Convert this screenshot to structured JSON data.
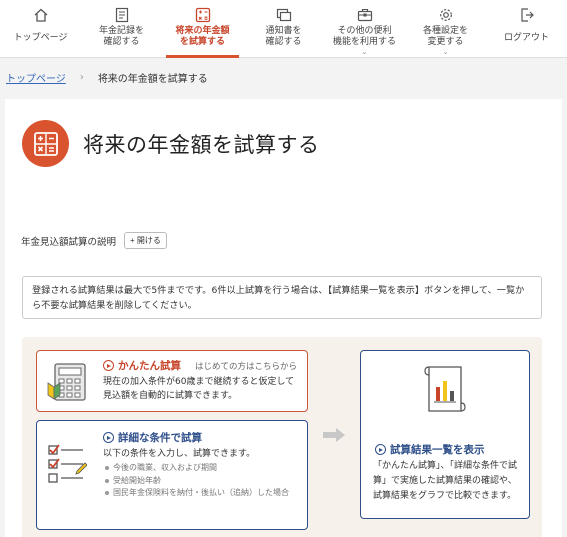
{
  "nav": {
    "items": [
      {
        "label": "トップページ",
        "icon": "home-icon"
      },
      {
        "label": "年金記録を\n確認する",
        "icon": "record-icon"
      },
      {
        "label": "将来の年金額\nを試算する",
        "icon": "calculator-icon",
        "active": true
      },
      {
        "label": "通知書を\n確認する",
        "icon": "notice-icon"
      },
      {
        "label": "その他の便利\n機能を利用する",
        "icon": "toolbox-icon",
        "chevron": "⌄"
      },
      {
        "label": "各種設定を\n変更する",
        "icon": "gear-icon",
        "chevron": "⌄"
      },
      {
        "label": "ログアウト",
        "icon": "logout-icon"
      }
    ]
  },
  "breadcrumb": {
    "home": "トップページ",
    "separator": "›",
    "current": "将来の年金額を試算する"
  },
  "page": {
    "title": "将来の年金額を試算する",
    "explain_label": "年金見込額試算の説明",
    "open_button": "+ 開ける",
    "notice": "登録される試算結果は最大で5件までです。6件以上試算を行う場合は、【試算結果一覧を表示】ボタンを押して、一覧から不要な試算結果を削除してください。"
  },
  "cards": {
    "easy": {
      "title": "かんたん試算",
      "subtitle": "はじめての方はこちらから",
      "body": "現在の加入条件が60歳まで継続すると仮定して見込額を自動的に試算できます。"
    },
    "detail": {
      "title": "詳細な条件で試算",
      "body": "以下の条件を入力し、試算できます。",
      "bullets": [
        "今後の職業、収入および期間",
        "受給開始年齢",
        "国民年金保険料を納付・後払い（追納）した場合"
      ]
    },
    "result": {
      "title": "試算結果一覧を表示",
      "body": "「かんたん試算」、「詳細な条件で試算」で実施した試算結果の確認や、試算結果をグラフで比較できます。"
    }
  },
  "colors": {
    "accent": "#d9532f",
    "navy": "#2f4f8a",
    "link": "#3467b7",
    "feature_bg": "#f6f1ea"
  }
}
